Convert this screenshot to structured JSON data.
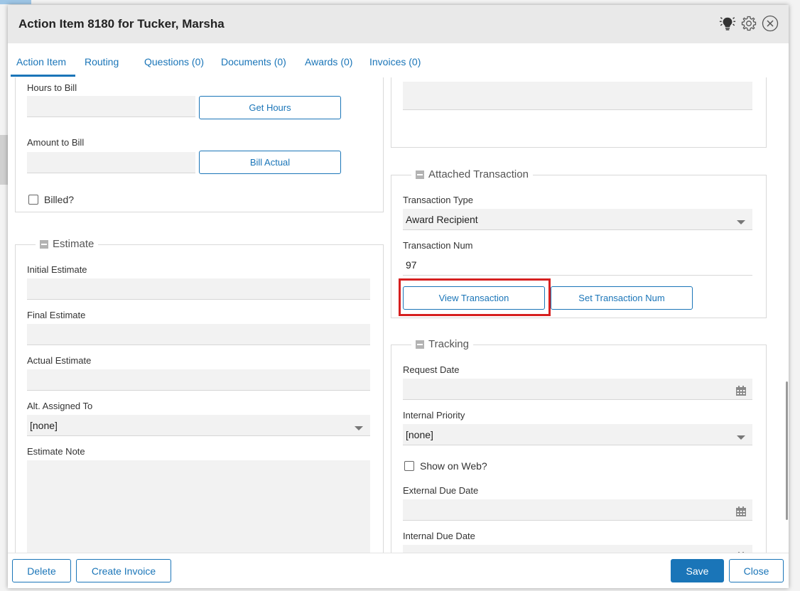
{
  "modal": {
    "title": "Action Item 8180 for Tucker, Marsha",
    "icons": [
      "lightbulb-icon",
      "gear-icon",
      "close-icon"
    ]
  },
  "tabs": [
    {
      "label": "Action Item",
      "active": true
    },
    {
      "label": "Routing"
    },
    {
      "label": "Questions (0)"
    },
    {
      "label": "Documents (0)"
    },
    {
      "label": "Awards (0)"
    },
    {
      "label": "Invoices (0)"
    }
  ],
  "billing": {
    "hours_label": "Hours to Bill",
    "hours_value": "",
    "get_hours_label": "Get Hours",
    "amount_label": "Amount to Bill",
    "amount_value": "",
    "bill_actual_label": "Bill Actual",
    "billed_label": "Billed?"
  },
  "estimate": {
    "legend": "Estimate",
    "initial_label": "Initial Estimate",
    "initial_value": "",
    "final_label": "Final Estimate",
    "final_value": "",
    "actual_label": "Actual Estimate",
    "actual_value": "",
    "alt_assigned_label": "Alt. Assigned To",
    "alt_assigned_value": "[none]",
    "note_label": "Estimate Note",
    "note_value": ""
  },
  "attached_transaction": {
    "legend": "Attached Transaction",
    "type_label": "Transaction Type",
    "type_value": "Award Recipient",
    "num_label": "Transaction Num",
    "num_value": "97",
    "view_label": "View Transaction",
    "set_label": "Set Transaction Num"
  },
  "tracking": {
    "legend": "Tracking",
    "request_date_label": "Request Date",
    "request_date_value": "",
    "priority_label": "Internal Priority",
    "priority_value": "[none]",
    "show_web_label": "Show on Web?",
    "external_due_label": "External Due Date",
    "external_due_value": "",
    "internal_due_label": "Internal Due Date",
    "internal_due_value": ""
  },
  "footer": {
    "delete_label": "Delete",
    "create_invoice_label": "Create Invoice",
    "save_label": "Save",
    "close_label": "Close"
  },
  "colors": {
    "accent": "#1a75b8",
    "highlight": "#d62020"
  }
}
